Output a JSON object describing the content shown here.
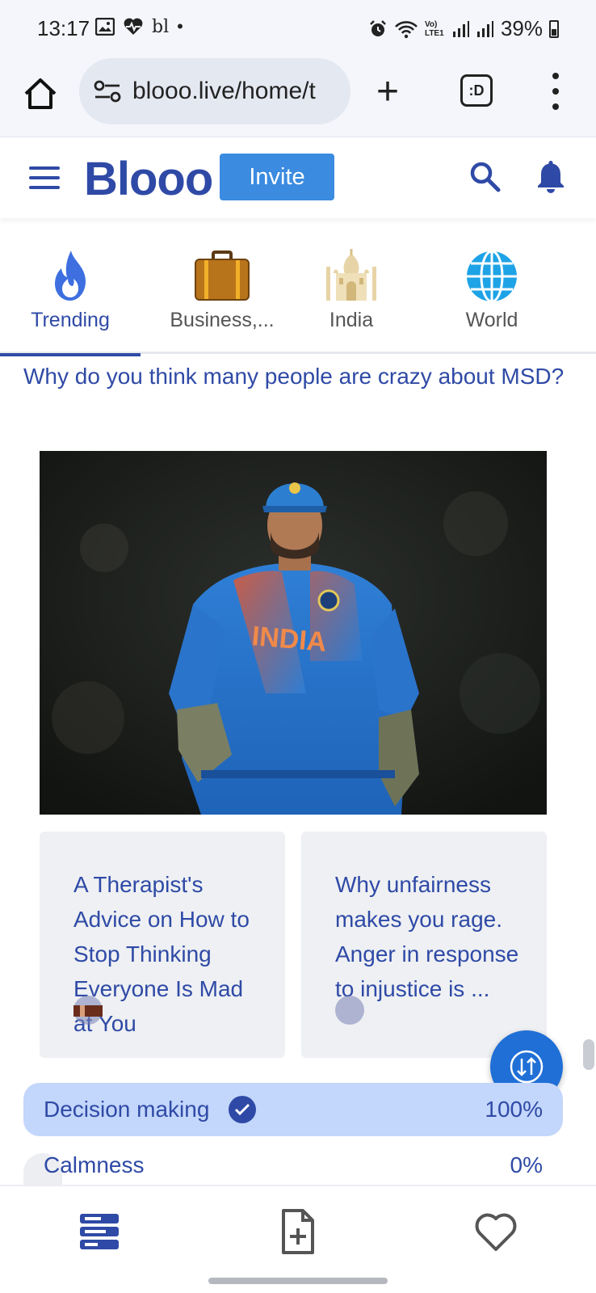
{
  "status_bar": {
    "time": "13:17",
    "left_extra": "bl",
    "battery": "39%",
    "network_label": "Vo) LTE1",
    "icons": [
      "image-icon",
      "heart-monitor-icon",
      "alarm-icon",
      "wifi-icon",
      "signal-icon",
      "battery-icon"
    ]
  },
  "browser": {
    "url": "blooo.live/home/t",
    "tabs_label": ":D",
    "icons": [
      "home-icon",
      "site-settings-icon",
      "new-tab-icon",
      "tabs-icon",
      "overflow-menu-icon"
    ]
  },
  "app_header": {
    "logo": "Blooo",
    "invite_label": "Invite",
    "icons": [
      "hamburger-menu-icon",
      "search-icon",
      "bell-icon"
    ]
  },
  "categories": [
    {
      "label": "Trending",
      "icon": "flame-icon",
      "active": true
    },
    {
      "label": "Business,...",
      "icon": "briefcase-icon",
      "active": false
    },
    {
      "label": "India",
      "icon": "taj-mahal-icon",
      "active": false
    },
    {
      "label": "World",
      "icon": "globe-icon",
      "active": false
    }
  ],
  "post": {
    "question": "Why do you think many people are crazy about MSD?",
    "image_text": "INDIA"
  },
  "related": [
    {
      "text": "A Therapist's Advice on How to Stop Thinking Everyone Is Mad at You"
    },
    {
      "text": "Why unfairness makes you rage. Anger in response to injustice is ..."
    }
  ],
  "poll": [
    {
      "label": "Decision making",
      "percent": "100%",
      "selected": true
    },
    {
      "label": "Calmness",
      "percent": "0%",
      "selected": false
    }
  ],
  "colors": {
    "brand": "#2f4aa6",
    "invite": "#3b8be0",
    "fab": "#1f6fd6",
    "poll_selected": "#c3d6fb"
  },
  "bottom_nav": [
    "feed-icon",
    "add-post-icon",
    "favorites-icon"
  ]
}
